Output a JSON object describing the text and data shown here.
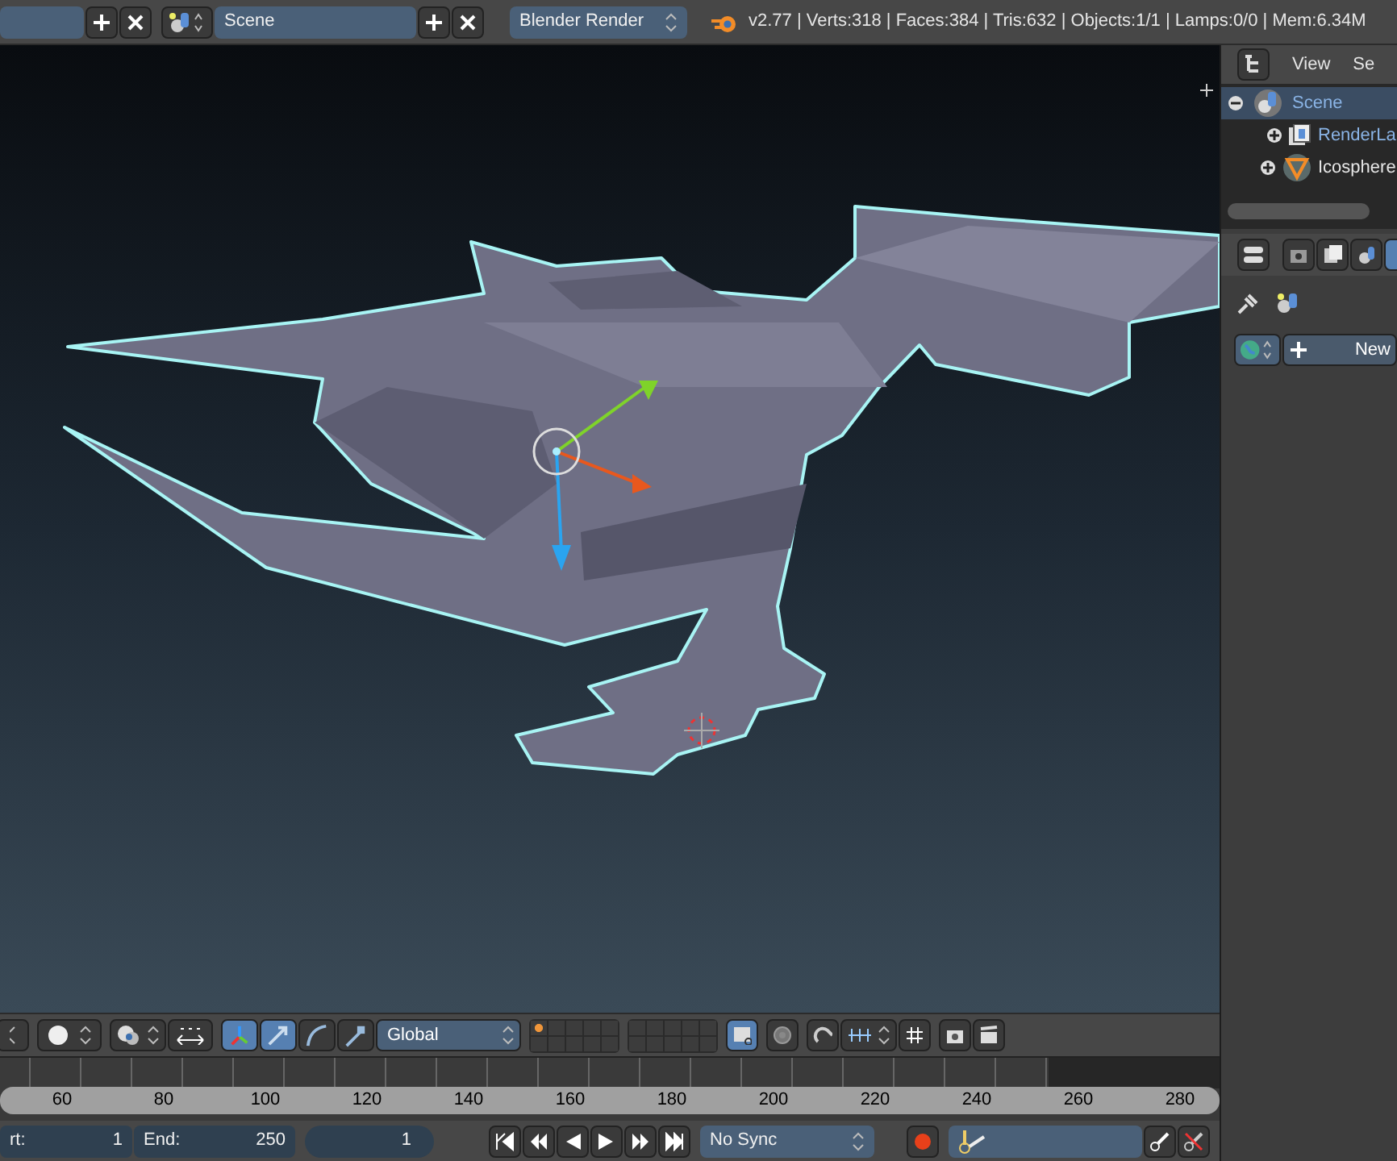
{
  "header": {
    "scene_field": "Scene",
    "render_engine": "Blender Render",
    "stats": "v2.77 | Verts:318 | Faces:384 | Tris:632 | Objects:1/1 | Lamps:0/0 | Mem:6.34M"
  },
  "outliner": {
    "menus": [
      "View",
      "Se"
    ],
    "tree": [
      {
        "label": "Scene",
        "expanded": true,
        "children": [
          {
            "label": "RenderLa",
            "expanded": false
          },
          {
            "label": "Icosphere",
            "expanded": false
          }
        ]
      }
    ]
  },
  "properties": {
    "tabs": [
      {
        "kind": "render",
        "selected": false
      },
      {
        "kind": "layers",
        "selected": false
      },
      {
        "kind": "scene",
        "selected": false
      },
      {
        "kind": "world",
        "selected": true
      }
    ],
    "world_button": "New"
  },
  "toolbar": {
    "manipulators": [
      {
        "kind": "toggle",
        "selected": true
      },
      {
        "kind": "translate",
        "selected": true
      },
      {
        "kind": "rotate",
        "selected": false
      },
      {
        "kind": "scale",
        "selected": false
      }
    ],
    "orientation": "Global",
    "layers": [
      {
        "occupied": true
      },
      {
        "occupied": false
      },
      {
        "occupied": false
      },
      {
        "occupied": false
      },
      {
        "occupied": false
      },
      {
        "occupied": false
      },
      {
        "occupied": false
      },
      {
        "occupied": false
      },
      {
        "occupied": false
      },
      {
        "occupied": false
      },
      {
        "occupied": false
      },
      {
        "occupied": false
      },
      {
        "occupied": false
      },
      {
        "occupied": false
      },
      {
        "occupied": false
      },
      {
        "occupied": false
      },
      {
        "occupied": false
      },
      {
        "occupied": false
      },
      {
        "occupied": false
      },
      {
        "occupied": false
      }
    ]
  },
  "timeline": {
    "ticks": [
      "60",
      "80",
      "100",
      "120",
      "140",
      "160",
      "180",
      "200",
      "220",
      "240",
      "260",
      "280"
    ]
  },
  "playback": {
    "start": {
      "label": "rt:",
      "value": "1"
    },
    "end": {
      "label": "End:",
      "value": "250"
    },
    "current": "1",
    "sync": "No Sync"
  }
}
